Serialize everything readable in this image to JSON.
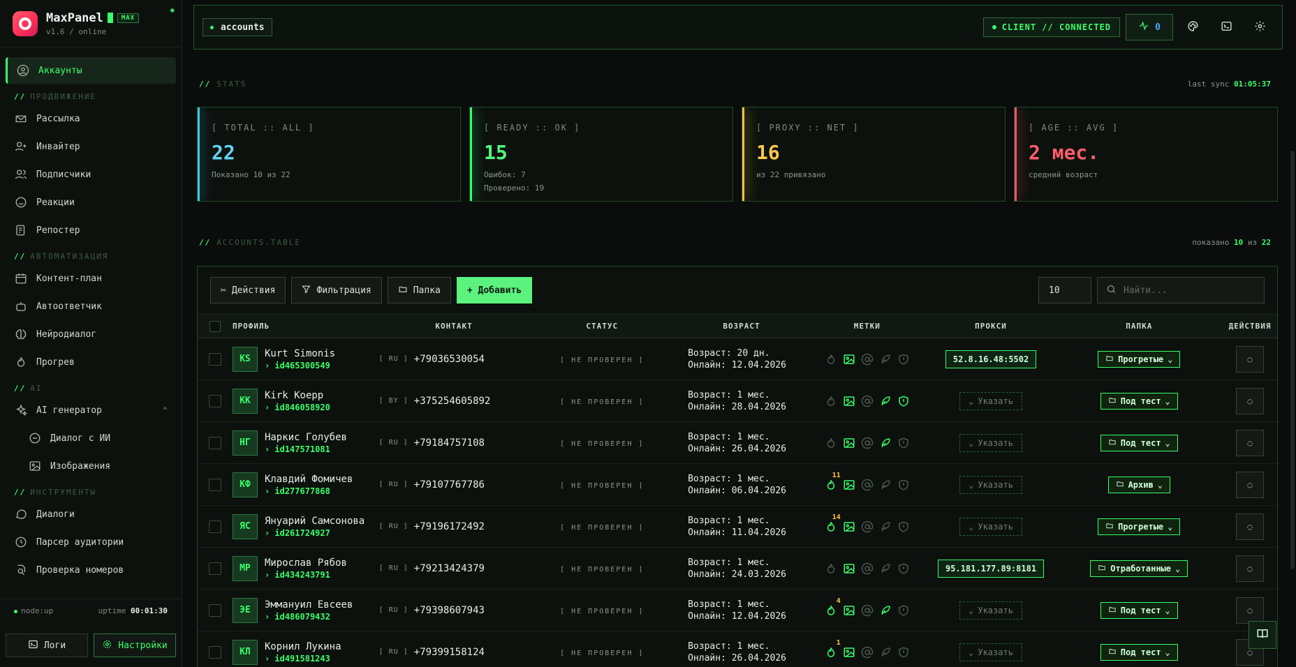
{
  "brand": {
    "name": "MaxPanel",
    "badge": "MAX",
    "version": "v1.6 / online"
  },
  "sidebar": {
    "top": [
      {
        "label": "Аккаунты",
        "icon": "user-circle-icon"
      }
    ],
    "sections": [
      {
        "title": "ПРОДВИЖЕНИЕ",
        "items": [
          {
            "label": "Рассылка",
            "icon": "send-icon"
          },
          {
            "label": "Инвайтер",
            "icon": "user-plus-icon"
          },
          {
            "label": "Подписчики",
            "icon": "users-icon"
          },
          {
            "label": "Реакции",
            "icon": "smile-icon"
          },
          {
            "label": "Репостер",
            "icon": "repost-icon"
          }
        ]
      },
      {
        "title": "АВТОМАТИЗАЦИЯ",
        "items": [
          {
            "label": "Контент-план",
            "icon": "calendar-icon"
          },
          {
            "label": "Автоответчик",
            "icon": "bot-icon"
          },
          {
            "label": "Нейродиалог",
            "icon": "brain-icon"
          },
          {
            "label": "Прогрев",
            "icon": "flame-icon"
          }
        ]
      },
      {
        "title": "AI",
        "items": [
          {
            "label": "AI генератор",
            "icon": "sparkles-icon"
          },
          {
            "label": "Диалог с ИИ",
            "icon": "chat-icon",
            "sub": true
          },
          {
            "label": "Изображения",
            "icon": "image-icon",
            "sub": true
          }
        ]
      },
      {
        "title": "ИНСТРУМЕНТЫ",
        "items": [
          {
            "label": "Диалоги",
            "icon": "message-icon"
          },
          {
            "label": "Парсер аудитории",
            "icon": "parser-icon"
          },
          {
            "label": "Проверка номеров",
            "icon": "check-number-icon"
          }
        ]
      }
    ],
    "status": {
      "node": "node:up",
      "uptime_label": "uptime",
      "uptime": "00:01:30"
    },
    "buttons": {
      "logs": "Логи",
      "settings": "Настройки"
    }
  },
  "topbar": {
    "crumb": "accounts",
    "connection": "CLIENT // CONNECTED",
    "pulse_count": "0"
  },
  "stats": {
    "heading": "STATS",
    "sync_label": "last sync",
    "sync_time": "01:05:37",
    "cards": [
      {
        "title": "[ TOTAL :: ALL ]",
        "value": "22",
        "sub1": "Показано 10 из 22",
        "sub2": ""
      },
      {
        "title": "[ READY :: OK ]",
        "value": "15",
        "sub1": "Ошибок: 7",
        "sub2": "Проверено: 19"
      },
      {
        "title": "[ PROXY :: NET ]",
        "value": "16",
        "sub1": "из 22 привязано",
        "sub2": ""
      },
      {
        "title": "[ AGE :: AVG ]",
        "value": "2 мес.",
        "sub1": "средний возраст",
        "sub2": ""
      }
    ]
  },
  "table": {
    "heading": "ACCOUNTS.TABLE",
    "shown_label": "показано",
    "shown": "10",
    "of_label": "из",
    "total": "22",
    "toolbar": {
      "actions": "Действия",
      "filter": "Фильтрация",
      "folder": "Папка",
      "add": "+ Добавить",
      "per_page": "10",
      "search_placeholder": "Найти..."
    },
    "columns": {
      "profile": "ПРОФИЛЬ",
      "contact": "КОНТАКТ",
      "status": "СТАТУС",
      "age": "ВОЗРАСТ",
      "tags": "МЕТКИ",
      "proxy": "ПРОКСИ",
      "folder": "ПАПКА",
      "actions": "ДЕЙСТВИЯ"
    },
    "rows": [
      {
        "initials": "KS",
        "name": "Kurt Simonis",
        "id": "› id465300549",
        "country": "[ RU ]",
        "phone": "+79036530054",
        "status": "[ НЕ ПРОВЕРЕН ]",
        "age": "Возраст: 20 дн.",
        "online": "Онлайн: 12.04.2026",
        "tags": [
          false,
          true,
          false,
          false,
          false
        ],
        "warm": "",
        "proxy": "52.8.16.48:5502",
        "folder": "Прогретые"
      },
      {
        "initials": "KK",
        "name": "Kirk Koepp",
        "id": "› id846058920",
        "country": "[ BY ]",
        "phone": "+375254605892",
        "status": "[ НЕ ПРОВЕРЕН ]",
        "age": "Возраст: 1 мес.",
        "online": "Онлайн: 28.04.2026",
        "tags": [
          false,
          true,
          false,
          true,
          true
        ],
        "warm": "",
        "proxy": "",
        "folder": "Под тест"
      },
      {
        "initials": "НГ",
        "name": "Наркис Голубев",
        "id": "› id147571081",
        "country": "[ RU ]",
        "phone": "+79184757108",
        "status": "[ НЕ ПРОВЕРЕН ]",
        "age": "Возраст: 1 мес.",
        "online": "Онлайн: 26.04.2026",
        "tags": [
          false,
          true,
          false,
          true,
          false
        ],
        "warm": "",
        "proxy": "",
        "folder": "Под тест"
      },
      {
        "initials": "КФ",
        "name": "Клавдий Фомичев",
        "id": "› id277677868",
        "country": "[ RU ]",
        "phone": "+79107767786",
        "status": "[ НЕ ПРОВЕРЕН ]",
        "age": "Возраст: 1 мес.",
        "online": "Онлайн: 06.04.2026",
        "tags": [
          true,
          true,
          false,
          false,
          false
        ],
        "warm": "11",
        "proxy": "",
        "folder": "Архив"
      },
      {
        "initials": "ЯС",
        "name": "Януарий Самсонова",
        "id": "› id261724927",
        "country": "[ RU ]",
        "phone": "+79196172492",
        "status": "[ НЕ ПРОВЕРЕН ]",
        "age": "Возраст: 1 мес.",
        "online": "Онлайн: 11.04.2026",
        "tags": [
          true,
          true,
          false,
          false,
          false
        ],
        "warm": "14",
        "proxy": "",
        "folder": "Прогретые"
      },
      {
        "initials": "МР",
        "name": "Мирослав Рябов",
        "id": "› id434243791",
        "country": "[ RU ]",
        "phone": "+79213424379",
        "status": "[ НЕ ПРОВЕРЕН ]",
        "age": "Возраст: 1 мес.",
        "online": "Онлайн: 24.03.2026",
        "tags": [
          false,
          true,
          false,
          false,
          false
        ],
        "warm": "",
        "proxy": "95.181.177.89:8181",
        "folder": "Отработанные"
      },
      {
        "initials": "ЭЕ",
        "name": "Эммануил Евсеев",
        "id": "› id486079432",
        "country": "[ RU ]",
        "phone": "+79398607943",
        "status": "[ НЕ ПРОВЕРЕН ]",
        "age": "Возраст: 1 мес.",
        "online": "Онлайн: 12.04.2026",
        "tags": [
          true,
          true,
          false,
          true,
          false
        ],
        "warm": "4",
        "proxy": "",
        "folder": "Под тест"
      },
      {
        "initials": "КЛ",
        "name": "Корнил Лукина",
        "id": "› id491581243",
        "country": "[ RU ]",
        "phone": "+79399158124",
        "status": "[ НЕ ПРОВЕРЕН ]",
        "age": "Возраст: 1 мес.",
        "online": "Онлайн: 26.04.2026",
        "tags": [
          true,
          true,
          false,
          false,
          false
        ],
        "warm": "1",
        "proxy": "",
        "folder": "Под тест"
      }
    ],
    "proxy_set_label": "Указать"
  },
  "colors": {
    "accent": "#39ff6a",
    "total": "#5fd3f0",
    "ready": "#4dff7c",
    "proxy": "#ffc84a",
    "age": "#ff5d6c",
    "count": "#ffc23d"
  }
}
